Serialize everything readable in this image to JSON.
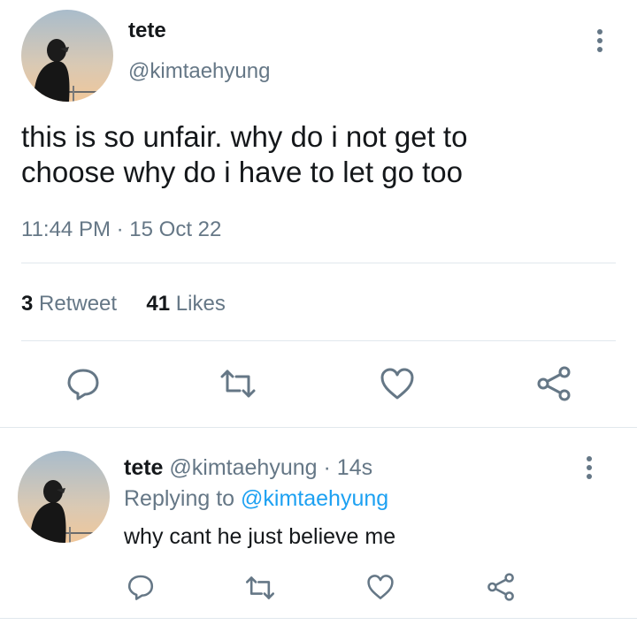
{
  "tweet": {
    "author_name": "tete",
    "author_handle": "@kimtaehyung",
    "text": "this is so unfair. why do i not get to choose why do i have to let go too",
    "time": "11:44 PM",
    "separator": "·",
    "date": "15 Oct 22",
    "retweet_count": "3",
    "retweet_label": "Retweet",
    "likes_count": "41",
    "likes_label": "Likes"
  },
  "reply": {
    "author_name": "tete",
    "author_handle": "@kimtaehyung",
    "separator": "·",
    "age": "14s",
    "replying_to_label": "Replying to",
    "replying_to_handle": "@kimtaehyung",
    "text": "why cant he just believe me"
  },
  "icons": {
    "more": "more-vertical-icon",
    "reply": "reply-icon",
    "retweet": "retweet-icon",
    "like": "heart-icon",
    "share": "share-icon"
  },
  "colors": {
    "text": "#14171a",
    "secondary": "#657786",
    "link": "#1da1f2",
    "divider": "#e1e8ed"
  }
}
